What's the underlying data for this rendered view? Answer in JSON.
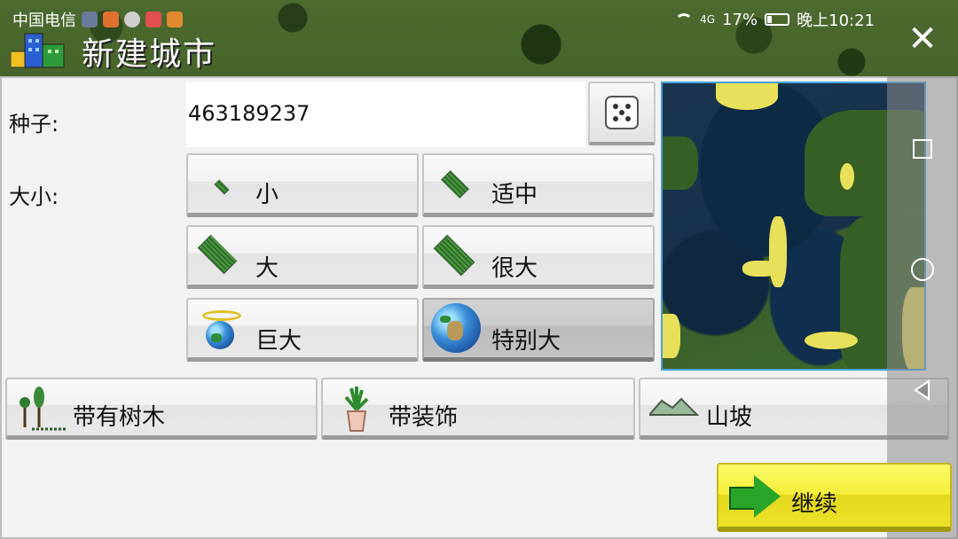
{
  "status_bar": {
    "carrier": "中国电信",
    "network": "4G",
    "battery": "17%",
    "time": "晚上10:21"
  },
  "title": "新建城市",
  "close_icon": "close-icon",
  "seed": {
    "label": "种子:",
    "value": "463189237",
    "random_icon": "dice-icon"
  },
  "size": {
    "label": "大小:",
    "selected": "特别大",
    "options": [
      "小",
      "适中",
      "大",
      "很大",
      "巨大",
      "特别大"
    ]
  },
  "toggles": [
    {
      "label": "带有树木",
      "icon": "trees-icon"
    },
    {
      "label": "带装饰",
      "icon": "plant-pot-icon"
    },
    {
      "label": "山坡",
      "icon": "hill-icon"
    }
  ],
  "continue_label": "继续",
  "colors": {
    "continue_bg": "#f7ef3a",
    "map_border": "#4aa0d8",
    "panel_bg": "#f2f2f2"
  }
}
